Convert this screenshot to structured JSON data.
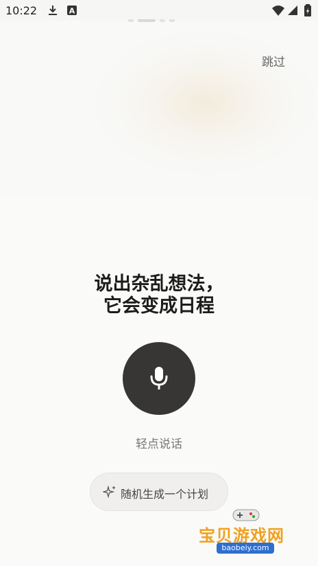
{
  "status_bar": {
    "time": "10:22"
  },
  "top": {
    "skip_label": "跳过"
  },
  "main": {
    "headline_line1": "说出杂乱想法，",
    "headline_line2": "它会变成日程",
    "tap_hint": "轻点说话",
    "random_plan_label": "随机生成一个计划"
  },
  "watermark": {
    "name": "宝贝游戏网",
    "url": "baobeiy.com"
  }
}
